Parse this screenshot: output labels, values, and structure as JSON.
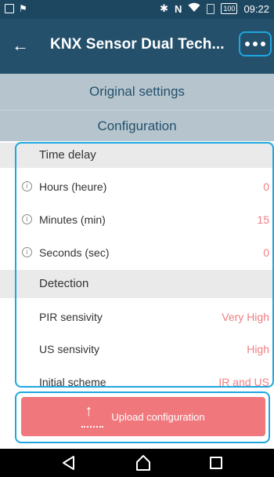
{
  "status_bar": {
    "time": "09:22",
    "battery": "100",
    "icons": [
      "screen-icon",
      "flag-icon",
      "bluetooth-icon",
      "nfc-icon",
      "wifi-icon",
      "sim-icon",
      "battery-icon"
    ]
  },
  "app_bar": {
    "title": "KNX Sensor Dual Tech...",
    "back_icon": "back-arrow-icon",
    "menu_icon": "more-icon"
  },
  "headers": {
    "original_settings": "Original settings",
    "configuration": "Configuration"
  },
  "sections": {
    "time_delay": {
      "title": "Time delay",
      "rows": [
        {
          "label": "Hours (heure)",
          "value": "0"
        },
        {
          "label": "Minutes (min)",
          "value": "15"
        },
        {
          "label": "Seconds (sec)",
          "value": "0"
        }
      ]
    },
    "detection": {
      "title": "Detection",
      "rows": [
        {
          "label": "PIR sensivity",
          "value": "Very High"
        },
        {
          "label": "US sensivity",
          "value": "High"
        },
        {
          "label": "Initial scheme",
          "value": "IR and US"
        }
      ]
    }
  },
  "upload": {
    "label": "Upload configuration",
    "icon": "upload-icon"
  },
  "colors": {
    "app_bar": "#24506c",
    "status_bar": "#1d4660",
    "header_band": "#b6c5cd",
    "accent_value": "#f07d82",
    "upload_button": "#f0787d",
    "highlight_outline": "#1ea7e0"
  }
}
